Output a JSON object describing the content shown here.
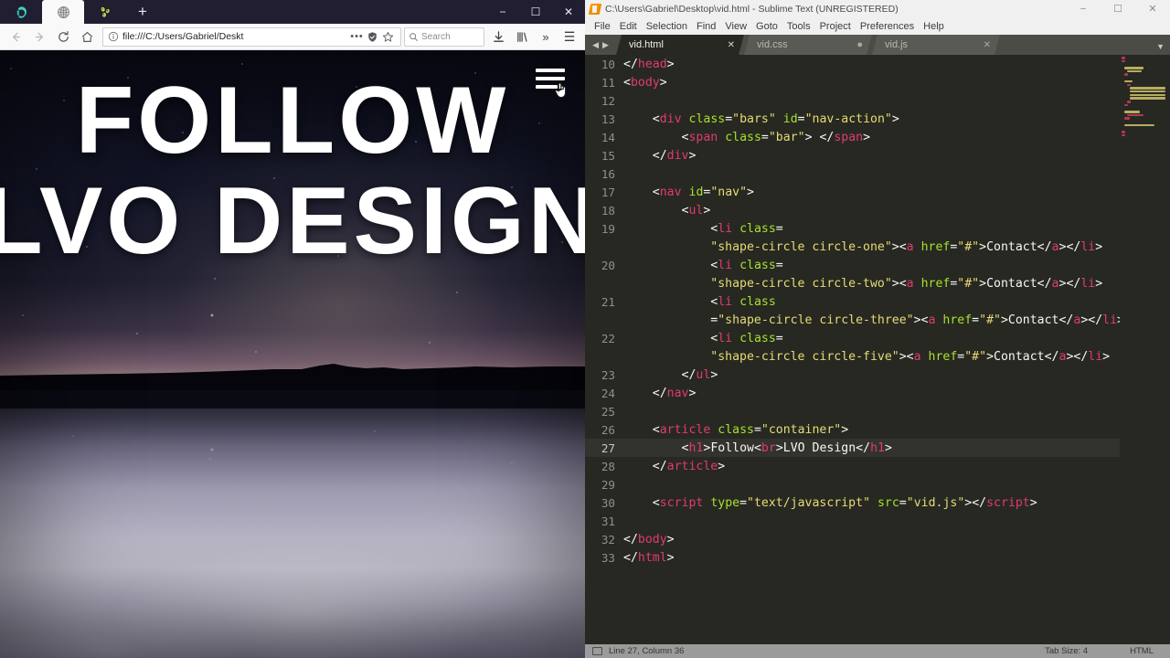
{
  "browser": {
    "name": "firefox-window",
    "tabs": [
      {
        "icon": "teal-app-icon",
        "active": false
      },
      {
        "icon": "globe-icon",
        "active": true
      },
      {
        "icon": "green-pattern-icon",
        "active": false
      }
    ],
    "new_tab_label": "+",
    "window_controls": {
      "minimize": "−",
      "maximize": "☐",
      "close": "✕"
    },
    "nav": {
      "back_label": "←",
      "forward_label": "→",
      "reload_label": "⟳",
      "home_label": "⌂"
    },
    "urlbar": {
      "info_icon": "info-circle-icon",
      "value": "file:///C:/Users/Gabriel/Deskt",
      "page_actions_label": "•••",
      "shield_icon": "shield-icon",
      "bookmark_icon": "star-icon"
    },
    "search": {
      "placeholder": "Search",
      "icon": "search-icon"
    },
    "toolbar_icons": {
      "downloads": "download-icon",
      "library": "library-icon",
      "overflow": "»",
      "menu": "☰"
    },
    "page": {
      "headline_line1": "FOLLOW",
      "headline_line2": "LVO DESIGN",
      "hamburger": "nav-action-bars",
      "cursor": "pointer-hand-cursor"
    }
  },
  "editor": {
    "title": "C:\\Users\\Gabriel\\Desktop\\vid.html - Sublime Text (UNREGISTERED)",
    "window_controls": {
      "minimize": "−",
      "maximize": "☐",
      "close": "✕"
    },
    "menu": [
      "File",
      "Edit",
      "Selection",
      "Find",
      "View",
      "Goto",
      "Tools",
      "Project",
      "Preferences",
      "Help"
    ],
    "tabs": [
      {
        "label": "vid.html",
        "state": "close",
        "state_glyph": "✕",
        "active": true
      },
      {
        "label": "vid.css",
        "state": "modified",
        "state_glyph": "●",
        "active": false
      },
      {
        "label": "vid.js",
        "state": "close",
        "state_glyph": "✕",
        "active": false
      }
    ],
    "tab_nav": {
      "prev": "◀",
      "next": "▶",
      "dropdown": "▼"
    },
    "active_line": 27,
    "lines": [
      {
        "n": 10,
        "tokens": [
          {
            "t": "punc",
            "v": "</"
          },
          {
            "t": "tag",
            "v": "head"
          },
          {
            "t": "punc",
            "v": ">"
          }
        ],
        "indent": 0
      },
      {
        "n": 11,
        "tokens": [
          {
            "t": "punc",
            "v": "<"
          },
          {
            "t": "tag",
            "v": "body"
          },
          {
            "t": "punc",
            "v": ">"
          }
        ],
        "indent": 0
      },
      {
        "n": 12,
        "tokens": [],
        "indent": 0
      },
      {
        "n": 13,
        "tokens": [
          {
            "t": "punc",
            "v": "<"
          },
          {
            "t": "tag",
            "v": "div"
          },
          {
            "t": "txt",
            "v": " "
          },
          {
            "t": "attr",
            "v": "class"
          },
          {
            "t": "punc",
            "v": "="
          },
          {
            "t": "val",
            "v": "\"bars\""
          },
          {
            "t": "txt",
            "v": " "
          },
          {
            "t": "attr",
            "v": "id"
          },
          {
            "t": "punc",
            "v": "="
          },
          {
            "t": "val",
            "v": "\"nav-action\""
          },
          {
            "t": "punc",
            "v": ">"
          }
        ],
        "indent": 1
      },
      {
        "n": 14,
        "tokens": [
          {
            "t": "punc",
            "v": "<"
          },
          {
            "t": "tag",
            "v": "span"
          },
          {
            "t": "txt",
            "v": " "
          },
          {
            "t": "attr",
            "v": "class"
          },
          {
            "t": "punc",
            "v": "="
          },
          {
            "t": "val",
            "v": "\"bar\""
          },
          {
            "t": "punc",
            "v": "> </"
          },
          {
            "t": "tag",
            "v": "span"
          },
          {
            "t": "punc",
            "v": ">"
          }
        ],
        "indent": 2
      },
      {
        "n": 15,
        "tokens": [
          {
            "t": "punc",
            "v": "</"
          },
          {
            "t": "tag",
            "v": "div"
          },
          {
            "t": "punc",
            "v": ">"
          }
        ],
        "indent": 1
      },
      {
        "n": 16,
        "tokens": [],
        "indent": 0
      },
      {
        "n": 17,
        "tokens": [
          {
            "t": "punc",
            "v": "<"
          },
          {
            "t": "tag",
            "v": "nav"
          },
          {
            "t": "txt",
            "v": " "
          },
          {
            "t": "attr",
            "v": "id"
          },
          {
            "t": "punc",
            "v": "="
          },
          {
            "t": "val",
            "v": "\"nav\""
          },
          {
            "t": "punc",
            "v": ">"
          }
        ],
        "indent": 1
      },
      {
        "n": 18,
        "tokens": [
          {
            "t": "punc",
            "v": "<"
          },
          {
            "t": "tag",
            "v": "ul"
          },
          {
            "t": "punc",
            "v": ">"
          }
        ],
        "indent": 2
      },
      {
        "n": 19,
        "tokens": [
          {
            "t": "punc",
            "v": "<"
          },
          {
            "t": "tag",
            "v": "li"
          },
          {
            "t": "txt",
            "v": " "
          },
          {
            "t": "attr",
            "v": "class"
          },
          {
            "t": "punc",
            "v": "="
          },
          {
            "t": "val",
            "v": "\"shape-circle circle-one\""
          },
          {
            "t": "punc",
            "v": "><"
          },
          {
            "t": "tag",
            "v": "a"
          },
          {
            "t": "txt",
            "v": " "
          },
          {
            "t": "attr",
            "v": "href"
          },
          {
            "t": "punc",
            "v": "="
          },
          {
            "t": "val",
            "v": "\"#\""
          },
          {
            "t": "punc",
            "v": ">"
          },
          {
            "t": "txt",
            "v": "Contact"
          },
          {
            "t": "punc",
            "v": "</"
          },
          {
            "t": "tag",
            "v": "a"
          },
          {
            "t": "punc",
            "v": "></"
          },
          {
            "t": "tag",
            "v": "li"
          },
          {
            "t": "punc",
            "v": ">"
          }
        ],
        "indent": 3,
        "wrap_after": 22
      },
      {
        "n": 20,
        "tokens": [
          {
            "t": "punc",
            "v": "<"
          },
          {
            "t": "tag",
            "v": "li"
          },
          {
            "t": "txt",
            "v": " "
          },
          {
            "t": "attr",
            "v": "class"
          },
          {
            "t": "punc",
            "v": "="
          },
          {
            "t": "val",
            "v": "\"shape-circle circle-two\""
          },
          {
            "t": "punc",
            "v": "><"
          },
          {
            "t": "tag",
            "v": "a"
          },
          {
            "t": "txt",
            "v": " "
          },
          {
            "t": "attr",
            "v": "href"
          },
          {
            "t": "punc",
            "v": "="
          },
          {
            "t": "val",
            "v": "\"#\""
          },
          {
            "t": "punc",
            "v": ">"
          },
          {
            "t": "txt",
            "v": "Contact"
          },
          {
            "t": "punc",
            "v": "</"
          },
          {
            "t": "tag",
            "v": "a"
          },
          {
            "t": "punc",
            "v": "></"
          },
          {
            "t": "tag",
            "v": "li"
          },
          {
            "t": "punc",
            "v": ">"
          }
        ],
        "indent": 3,
        "wrap_after": 22
      },
      {
        "n": 21,
        "tokens": [
          {
            "t": "punc",
            "v": "<"
          },
          {
            "t": "tag",
            "v": "li"
          },
          {
            "t": "txt",
            "v": " "
          },
          {
            "t": "attr",
            "v": "class"
          },
          {
            "t": "punc",
            "v": "="
          },
          {
            "t": "val",
            "v": "\"shape-circle circle-three\""
          },
          {
            "t": "punc",
            "v": "><"
          },
          {
            "t": "tag",
            "v": "a"
          },
          {
            "t": "txt",
            "v": " "
          },
          {
            "t": "attr",
            "v": "href"
          },
          {
            "t": "punc",
            "v": "="
          },
          {
            "t": "val",
            "v": "\"#\""
          },
          {
            "t": "punc",
            "v": ">"
          },
          {
            "t": "txt",
            "v": "Contact"
          },
          {
            "t": "punc",
            "v": "</"
          },
          {
            "t": "tag",
            "v": "a"
          },
          {
            "t": "punc",
            "v": "></"
          },
          {
            "t": "tag",
            "v": "li"
          },
          {
            "t": "punc",
            "v": ">"
          }
        ],
        "indent": 3,
        "wrap_after": 21
      },
      {
        "n": 22,
        "tokens": [
          {
            "t": "punc",
            "v": "<"
          },
          {
            "t": "tag",
            "v": "li"
          },
          {
            "t": "txt",
            "v": " "
          },
          {
            "t": "attr",
            "v": "class"
          },
          {
            "t": "punc",
            "v": "="
          },
          {
            "t": "val",
            "v": "\"shape-circle circle-five\""
          },
          {
            "t": "punc",
            "v": "><"
          },
          {
            "t": "tag",
            "v": "a"
          },
          {
            "t": "txt",
            "v": " "
          },
          {
            "t": "attr",
            "v": "href"
          },
          {
            "t": "punc",
            "v": "="
          },
          {
            "t": "val",
            "v": "\"#\""
          },
          {
            "t": "punc",
            "v": ">"
          },
          {
            "t": "txt",
            "v": "Contact"
          },
          {
            "t": "punc",
            "v": "</"
          },
          {
            "t": "tag",
            "v": "a"
          },
          {
            "t": "punc",
            "v": "></"
          },
          {
            "t": "tag",
            "v": "li"
          },
          {
            "t": "punc",
            "v": ">"
          }
        ],
        "indent": 3,
        "wrap_after": 22
      },
      {
        "n": 23,
        "tokens": [
          {
            "t": "punc",
            "v": "</"
          },
          {
            "t": "tag",
            "v": "ul"
          },
          {
            "t": "punc",
            "v": ">"
          }
        ],
        "indent": 2
      },
      {
        "n": 24,
        "tokens": [
          {
            "t": "punc",
            "v": "</"
          },
          {
            "t": "tag",
            "v": "nav"
          },
          {
            "t": "punc",
            "v": ">"
          }
        ],
        "indent": 1
      },
      {
        "n": 25,
        "tokens": [],
        "indent": 0
      },
      {
        "n": 26,
        "tokens": [
          {
            "t": "punc",
            "v": "<"
          },
          {
            "t": "tag",
            "v": "article"
          },
          {
            "t": "txt",
            "v": " "
          },
          {
            "t": "attr",
            "v": "class"
          },
          {
            "t": "punc",
            "v": "="
          },
          {
            "t": "val",
            "v": "\"container\""
          },
          {
            "t": "punc",
            "v": ">"
          }
        ],
        "indent": 1
      },
      {
        "n": 27,
        "tokens": [
          {
            "t": "punc",
            "v": "<"
          },
          {
            "t": "tag",
            "v": "h1"
          },
          {
            "t": "punc",
            "v": ">"
          },
          {
            "t": "txt",
            "v": "Follow"
          },
          {
            "t": "punc",
            "v": "<"
          },
          {
            "t": "tag",
            "v": "br"
          },
          {
            "t": "punc",
            "v": ">"
          },
          {
            "t": "txt",
            "v": "LVO Design"
          },
          {
            "t": "punc",
            "v": "</"
          },
          {
            "t": "tag",
            "v": "h1"
          },
          {
            "t": "punc",
            "v": ">"
          }
        ],
        "indent": 2
      },
      {
        "n": 28,
        "tokens": [
          {
            "t": "punc",
            "v": "</"
          },
          {
            "t": "tag",
            "v": "article"
          },
          {
            "t": "punc",
            "v": ">"
          }
        ],
        "indent": 1
      },
      {
        "n": 29,
        "tokens": [],
        "indent": 0
      },
      {
        "n": 30,
        "tokens": [
          {
            "t": "punc",
            "v": "<"
          },
          {
            "t": "tag",
            "v": "script"
          },
          {
            "t": "txt",
            "v": " "
          },
          {
            "t": "attr",
            "v": "type"
          },
          {
            "t": "punc",
            "v": "="
          },
          {
            "t": "val",
            "v": "\"text/javascript\""
          },
          {
            "t": "txt",
            "v": " "
          },
          {
            "t": "attr",
            "v": "src"
          },
          {
            "t": "punc",
            "v": "="
          },
          {
            "t": "val",
            "v": "\"vid.js\""
          },
          {
            "t": "punc",
            "v": "></"
          },
          {
            "t": "tag",
            "v": "script"
          },
          {
            "t": "punc",
            "v": ">"
          }
        ],
        "indent": 1
      },
      {
        "n": 31,
        "tokens": [],
        "indent": 0
      },
      {
        "n": 32,
        "tokens": [
          {
            "t": "punc",
            "v": "</"
          },
          {
            "t": "tag",
            "v": "body"
          },
          {
            "t": "punc",
            "v": ">"
          }
        ],
        "indent": 0
      },
      {
        "n": 33,
        "tokens": [
          {
            "t": "punc",
            "v": "</"
          },
          {
            "t": "tag",
            "v": "html"
          },
          {
            "t": "punc",
            "v": ">"
          }
        ],
        "indent": 0
      }
    ],
    "status": {
      "position": "Line 27, Column 36",
      "tab_size": "Tab Size: 4",
      "syntax": "HTML"
    },
    "colors": {
      "background": "#272822",
      "tag": "#e03c6e",
      "attribute": "#a6e22e",
      "value": "#e6db74",
      "text": "#f8f8f2",
      "gutter": "#8f908a",
      "active_line": "#32332c"
    }
  }
}
